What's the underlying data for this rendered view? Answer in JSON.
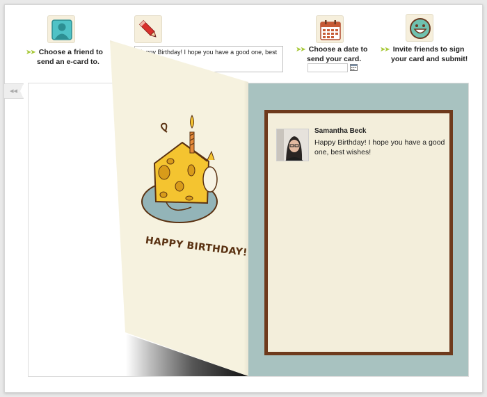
{
  "steps": [
    {
      "line1": "Choose a friend to",
      "line2": "send an e-card to.",
      "icon": "person-icon"
    },
    {
      "message": "Happy Birthday! I hope you have a good one, best wishes!",
      "icon": "pencil-icon"
    },
    {
      "line1": "Choose a date to",
      "line2": "send your card.",
      "icon": "calendar-icon"
    },
    {
      "line1": "Invite friends to sign",
      "line2": "your card and submit!",
      "icon": "smiley-icon"
    }
  ],
  "collapse_label": "◂◂",
  "card": {
    "cover_text": "HAPPY BIRTHDAY!",
    "sender_name": "Samantha Beck",
    "sender_message": "Happy Birthday! I hope you have a good one, best wishes!"
  },
  "colors": {
    "accent_arrow": "#a8c93a",
    "card_frame": "#6e3a1c",
    "card_background": "#a8c2c0",
    "page_cream": "#f6f2df"
  }
}
